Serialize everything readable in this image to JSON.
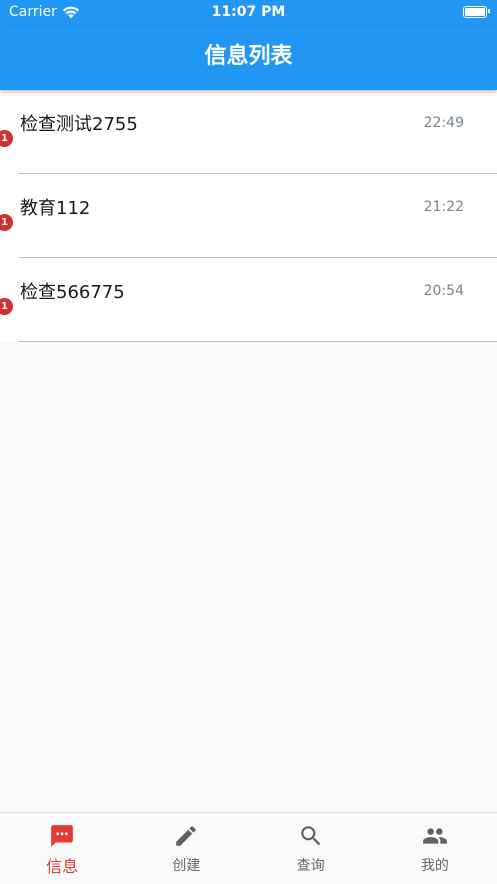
{
  "status_bar": {
    "carrier": "Carrier",
    "time": "11:07 PM"
  },
  "header": {
    "title": "信息列表"
  },
  "messages": [
    {
      "title": "检查测试2755",
      "time": "22:49",
      "badge": "1"
    },
    {
      "title": "教育112",
      "time": "21:22",
      "badge": "1"
    },
    {
      "title": "检查566775",
      "time": "20:54",
      "badge": "1"
    }
  ],
  "bottom_nav": [
    {
      "label": "信息",
      "icon": "chat-icon",
      "active": true
    },
    {
      "label": "创建",
      "icon": "pencil-icon",
      "active": false
    },
    {
      "label": "查询",
      "icon": "search-icon",
      "active": false
    },
    {
      "label": "我的",
      "icon": "people-icon",
      "active": false
    }
  ],
  "colors": {
    "primary": "#2196f3",
    "active_tab": "#e53935",
    "badge": "#d32f2f",
    "inactive_icon": "#616161"
  }
}
